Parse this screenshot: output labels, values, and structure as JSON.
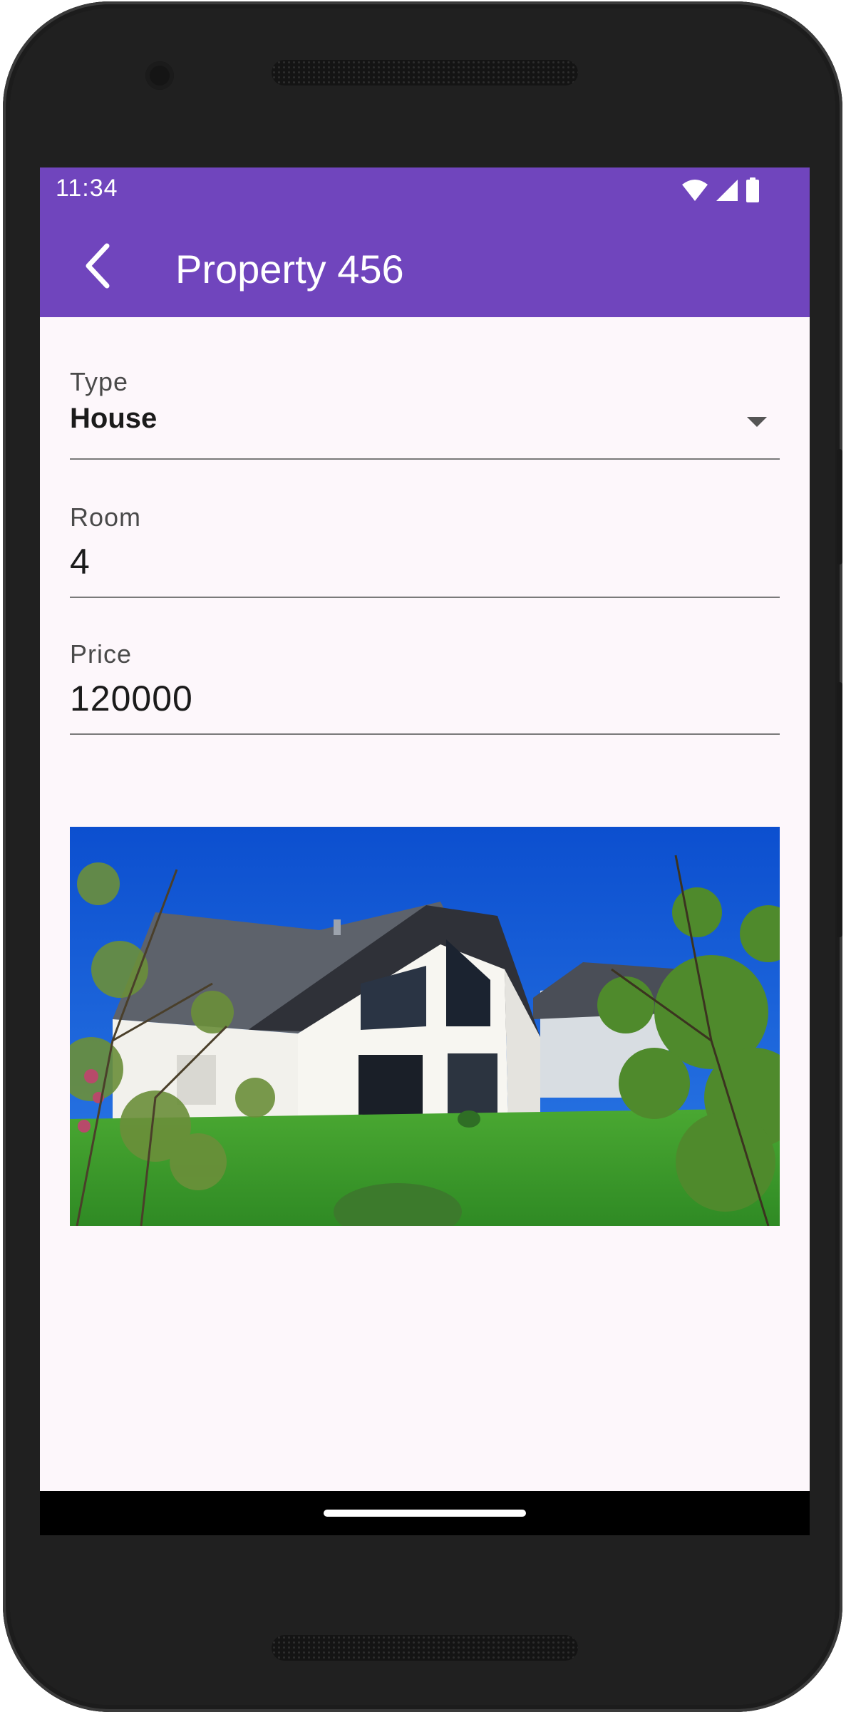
{
  "status_bar": {
    "time": "11:34",
    "icons": [
      "wifi-icon",
      "cell-signal-icon",
      "battery-icon"
    ]
  },
  "app_bar": {
    "back_icon": "back-arrow-icon",
    "title": "Property 456",
    "color": "#7045bd"
  },
  "form": {
    "type": {
      "label": "Type",
      "value": "House",
      "icon": "dropdown-arrow-icon"
    },
    "room": {
      "label": "Room",
      "value": "4"
    },
    "price": {
      "label": "Price",
      "value": "120000"
    }
  },
  "photo": {
    "alt": "House",
    "sky_color": "#1a5ed6",
    "lawn_color": "#3f9a2e"
  },
  "colors": {
    "screen_background": "#fdf7fb",
    "field_underline": "#7a7a7a"
  }
}
